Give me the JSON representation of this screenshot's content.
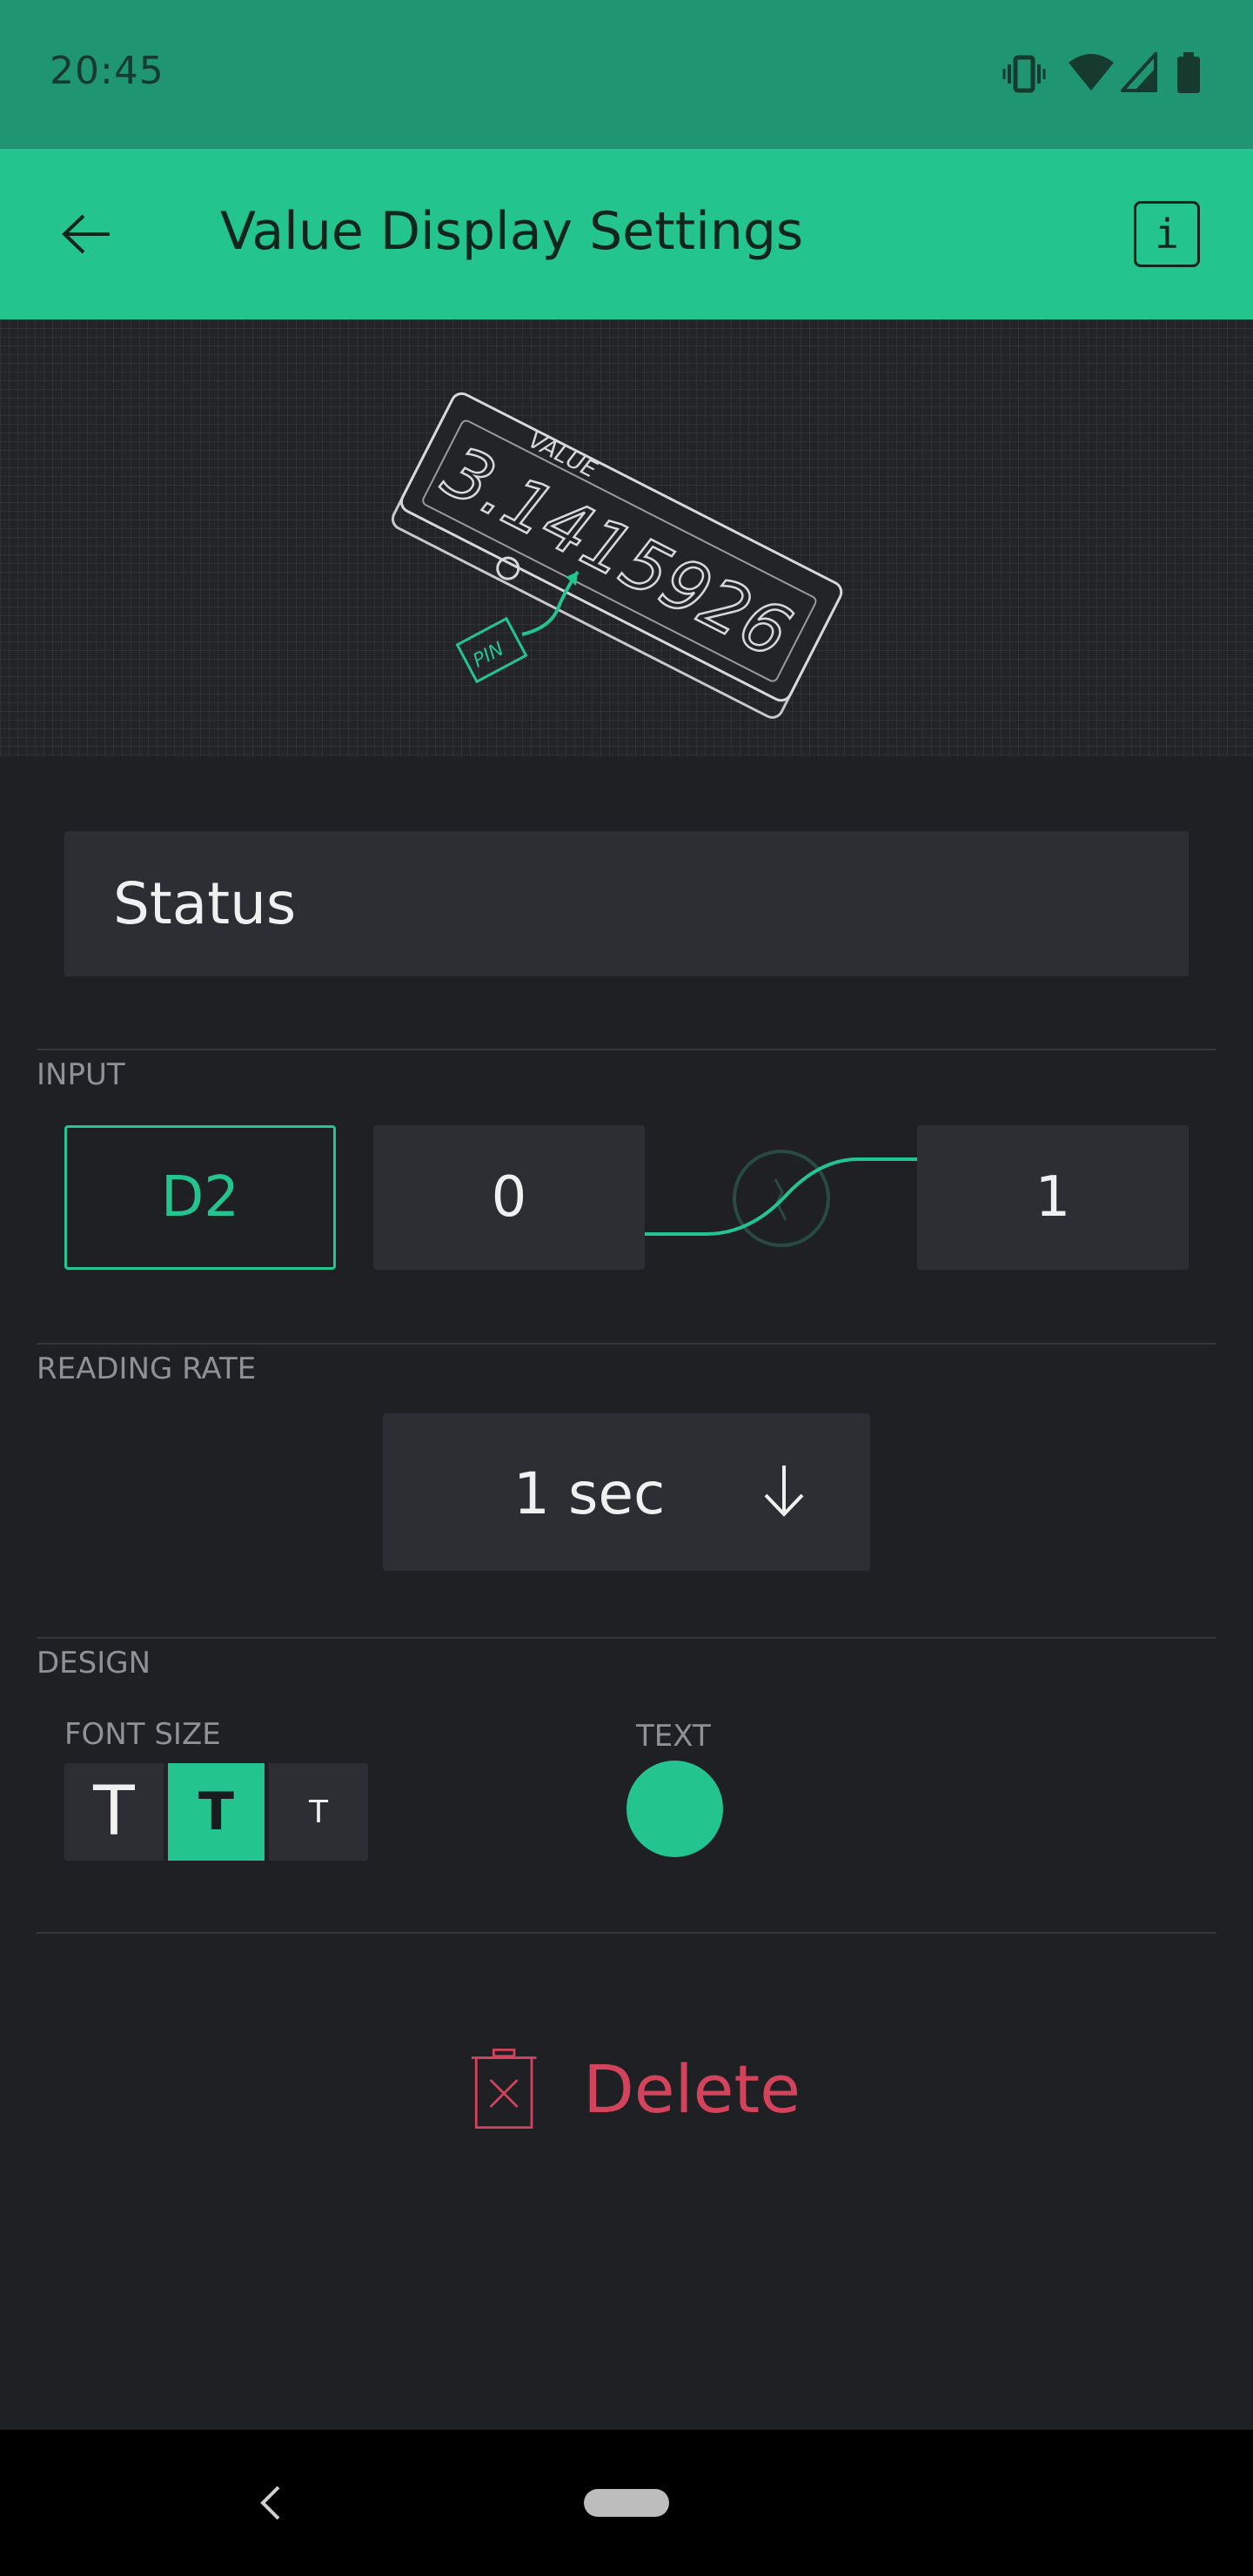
{
  "status_bar": {
    "time": "20:45",
    "icons": [
      "vibrate-icon",
      "wifi-icon",
      "signal-icon",
      "battery-icon"
    ]
  },
  "toolbar": {
    "title": "Value Display Settings",
    "info_label": "i",
    "back_icon": "arrow-left-icon"
  },
  "hero": {
    "device_label": "VALUE",
    "device_value": "3.1415926",
    "pin_label": "PIN"
  },
  "name_field": {
    "value": "Status"
  },
  "input": {
    "label": "INPUT",
    "pin": "D2",
    "min": "0",
    "max": "1"
  },
  "reading_rate": {
    "label": "READING RATE",
    "value": "1 sec"
  },
  "design": {
    "label": "DESIGN",
    "font_size_label": "FONT SIZE",
    "font_sizes": [
      "T",
      "T",
      "T"
    ],
    "selected_font_size": 1,
    "text_label": "TEXT",
    "text_color": "#23c48e"
  },
  "delete": {
    "label": "Delete"
  },
  "colors": {
    "accent": "#23c48e",
    "danger": "#d3435c",
    "background": "#1f2024"
  }
}
